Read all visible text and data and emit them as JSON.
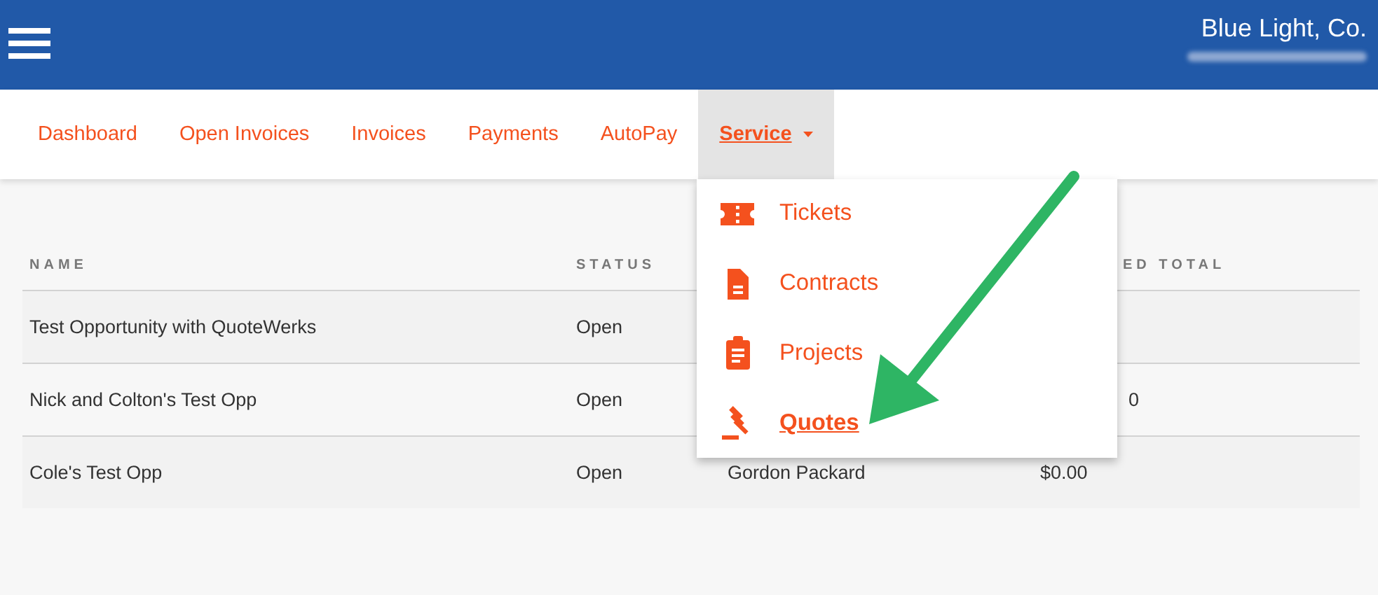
{
  "header": {
    "company": "Blue Light, Co."
  },
  "nav": [
    {
      "label": "Dashboard",
      "selected": false
    },
    {
      "label": "Open Invoices",
      "selected": false
    },
    {
      "label": "Invoices",
      "selected": false
    },
    {
      "label": "Payments",
      "selected": false
    },
    {
      "label": "AutoPay",
      "selected": false
    },
    {
      "label": "Service",
      "selected": true,
      "dropdown": true
    }
  ],
  "menu": [
    {
      "label": "Tickets",
      "kind": "ticket",
      "selected": false
    },
    {
      "label": "Contracts",
      "kind": "document",
      "selected": false
    },
    {
      "label": "Projects",
      "kind": "clipboard",
      "selected": false
    },
    {
      "label": "Quotes",
      "kind": "gavel",
      "selected": true
    }
  ],
  "table": {
    "columns": [
      "NAME",
      "STATUS",
      null,
      "ED TOTAL"
    ],
    "rows": [
      [
        "Test Opportunity with QuoteWerks",
        "Open",
        null,
        null
      ],
      [
        "Nick and Colton's Test Opp",
        "Open",
        null,
        "0"
      ],
      [
        "Cole's Test Opp",
        "Open",
        "Gordon Packard",
        "$0.00"
      ]
    ]
  }
}
